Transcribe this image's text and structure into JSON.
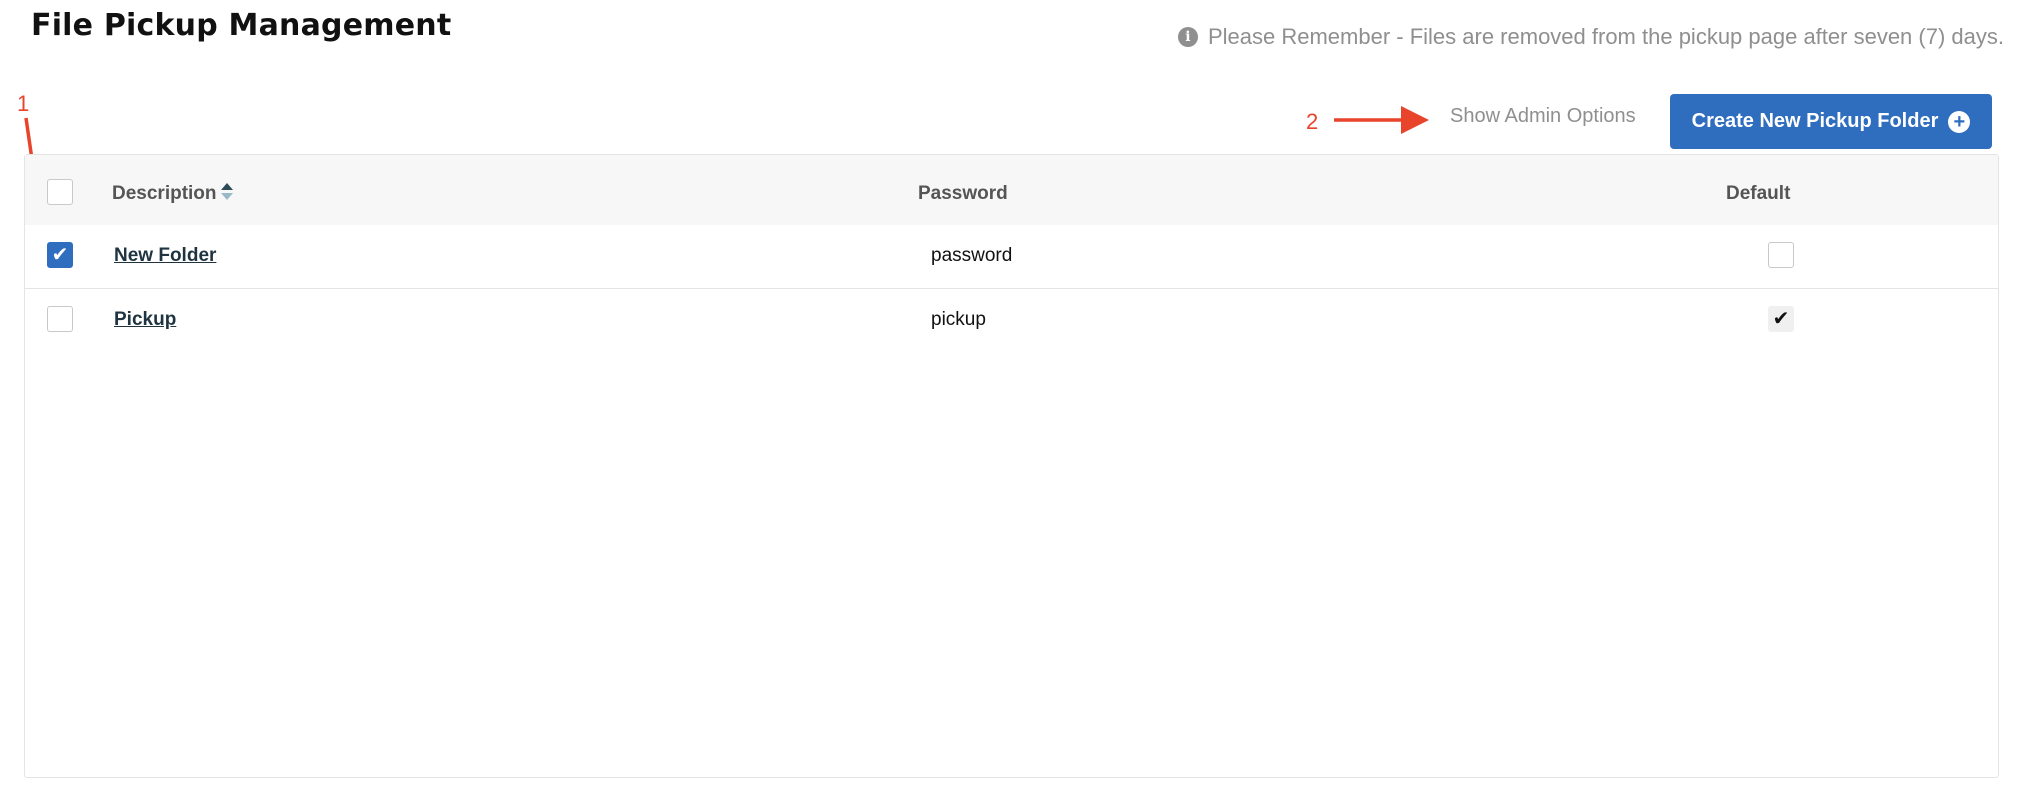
{
  "header": {
    "title": "File Pickup Management",
    "notice_icon": "info-circle-icon",
    "notice": "Please Remember - Files are removed from the pickup page after seven (7) days."
  },
  "annotations": {
    "marker_1": "1",
    "marker_2": "2",
    "color": "#e8442c"
  },
  "toolbar": {
    "admin_options_label": "Show Admin Options",
    "create_button_label": "Create New Pickup Folder",
    "create_button_icon": "plus-circle-icon",
    "accent_color": "#2f6dbf"
  },
  "table": {
    "columns": {
      "description": "Description",
      "password": "Password",
      "default": "Default"
    },
    "sort_column": "description",
    "rows": [
      {
        "description": "New Folder",
        "password": "password",
        "selected": true,
        "is_default": false
      },
      {
        "description": "Pickup",
        "password": "pickup",
        "selected": false,
        "is_default": true
      }
    ]
  }
}
